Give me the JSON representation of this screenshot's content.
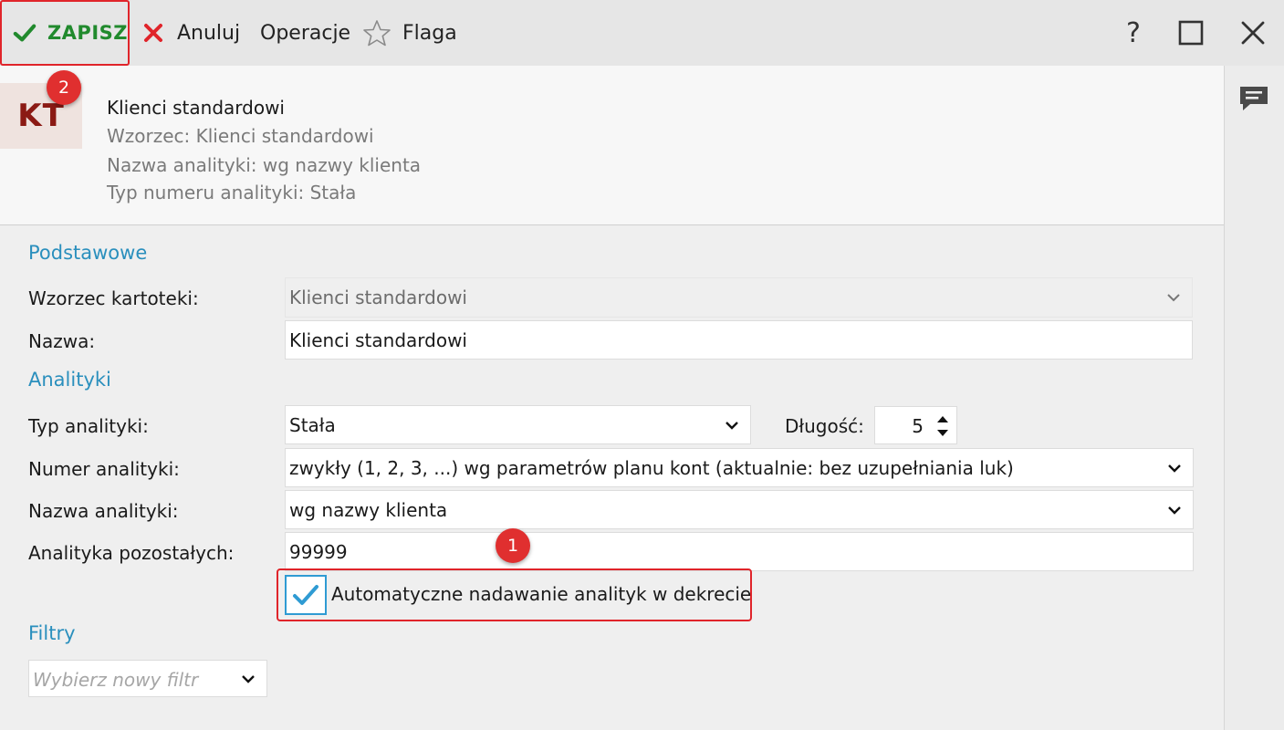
{
  "toolbar": {
    "save_label": "ZAPISZ",
    "cancel_label": "Anuluj",
    "operations_label": "Operacje",
    "flag_label": "Flaga",
    "help_label": "?"
  },
  "header": {
    "avatar_initials": "KT",
    "title": "Klienci standardowi",
    "line2": "Wzorzec: Klienci standardowi",
    "line3": "Nazwa analityki: wg nazwy klienta",
    "line4": "Typ numeru analityki: Stała"
  },
  "badges": {
    "save": "2",
    "checkbox": "1"
  },
  "form": {
    "section_basic": "Podstawowe",
    "template_label": "Wzorzec kartoteki:",
    "template_value": "Klienci standardowi",
    "name_label": "Nazwa:",
    "name_value": "Klienci standardowi",
    "section_analytics": "Analityki",
    "analytics_type_label": "Typ analityki:",
    "analytics_type_value": "Stała",
    "length_label": "Długość:",
    "length_value": "5",
    "analytics_number_label": "Numer analityki:",
    "analytics_number_value": "zwykły (1, 2, 3, ...) wg parametrów planu kont (aktualnie: bez uzupełniania luk)",
    "analytics_name_label": "Nazwa analityki:",
    "analytics_name_value": "wg nazwy klienta",
    "analytics_other_label": "Analityka pozostałych:",
    "analytics_other_value": "99999",
    "auto_assign_label": "Automatyczne nadawanie analityk w dekrecie",
    "auto_assign_checked": true,
    "section_filters": "Filtry",
    "filter_placeholder": "Wybierz nowy filtr"
  },
  "colors": {
    "accent_blue": "#2a8fbd",
    "save_green": "#218a2d",
    "highlight_red": "#e0242a",
    "avatar_text": "#8b1a14"
  },
  "icons": [
    "check-icon",
    "close-x-icon",
    "star-icon",
    "help-icon",
    "maximize-icon",
    "close-window-icon",
    "comments-icon",
    "chevron-down-icon",
    "spinner-arrows-icon"
  ]
}
